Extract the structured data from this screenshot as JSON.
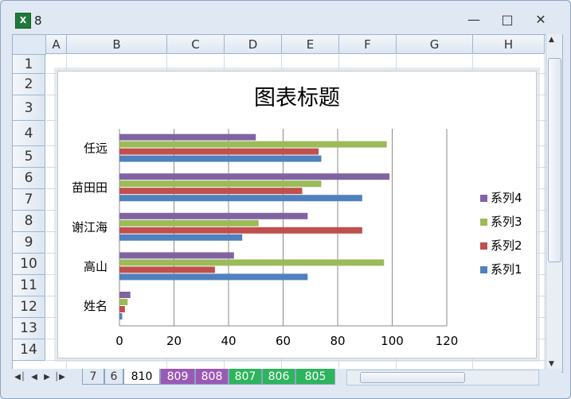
{
  "window": {
    "title": "8",
    "app_icon": "excel-icon"
  },
  "columns": [
    "A",
    "B",
    "C",
    "D",
    "E",
    "F",
    "G",
    "H"
  ],
  "rows": [
    "1",
    "2",
    "3",
    "4",
    "5",
    "6",
    "7",
    "8",
    "9",
    "10",
    "11",
    "12",
    "13",
    "14"
  ],
  "sheet_tabs": [
    "7",
    "6",
    "810",
    "809",
    "808",
    "807",
    "806",
    "805"
  ],
  "active_tab": "810",
  "colors": {
    "series1": "#4f81bd",
    "series2": "#c0504d",
    "series3": "#9bbb59",
    "series4": "#8064a2",
    "tab_purple": "#9b59b6",
    "tab_green": "#2db55d"
  },
  "chart_data": {
    "type": "bar",
    "orientation": "horizontal",
    "title": "图表标题",
    "categories": [
      "姓名",
      "高山",
      "谢江海",
      "苗田田",
      "任远"
    ],
    "series": [
      {
        "name": "系列1",
        "values": [
          1,
          69,
          45,
          89,
          74
        ]
      },
      {
        "name": "系列2",
        "values": [
          2,
          35,
          89,
          67,
          73
        ]
      },
      {
        "name": "系列3",
        "values": [
          3,
          97,
          51,
          74,
          98
        ]
      },
      {
        "name": "系列4",
        "values": [
          4,
          42,
          69,
          99,
          50
        ]
      }
    ],
    "x_ticks": [
      "0",
      "20",
      "40",
      "60",
      "80",
      "100",
      "120"
    ],
    "xlim": [
      0,
      120
    ],
    "grid": true,
    "legend_position": "right"
  }
}
